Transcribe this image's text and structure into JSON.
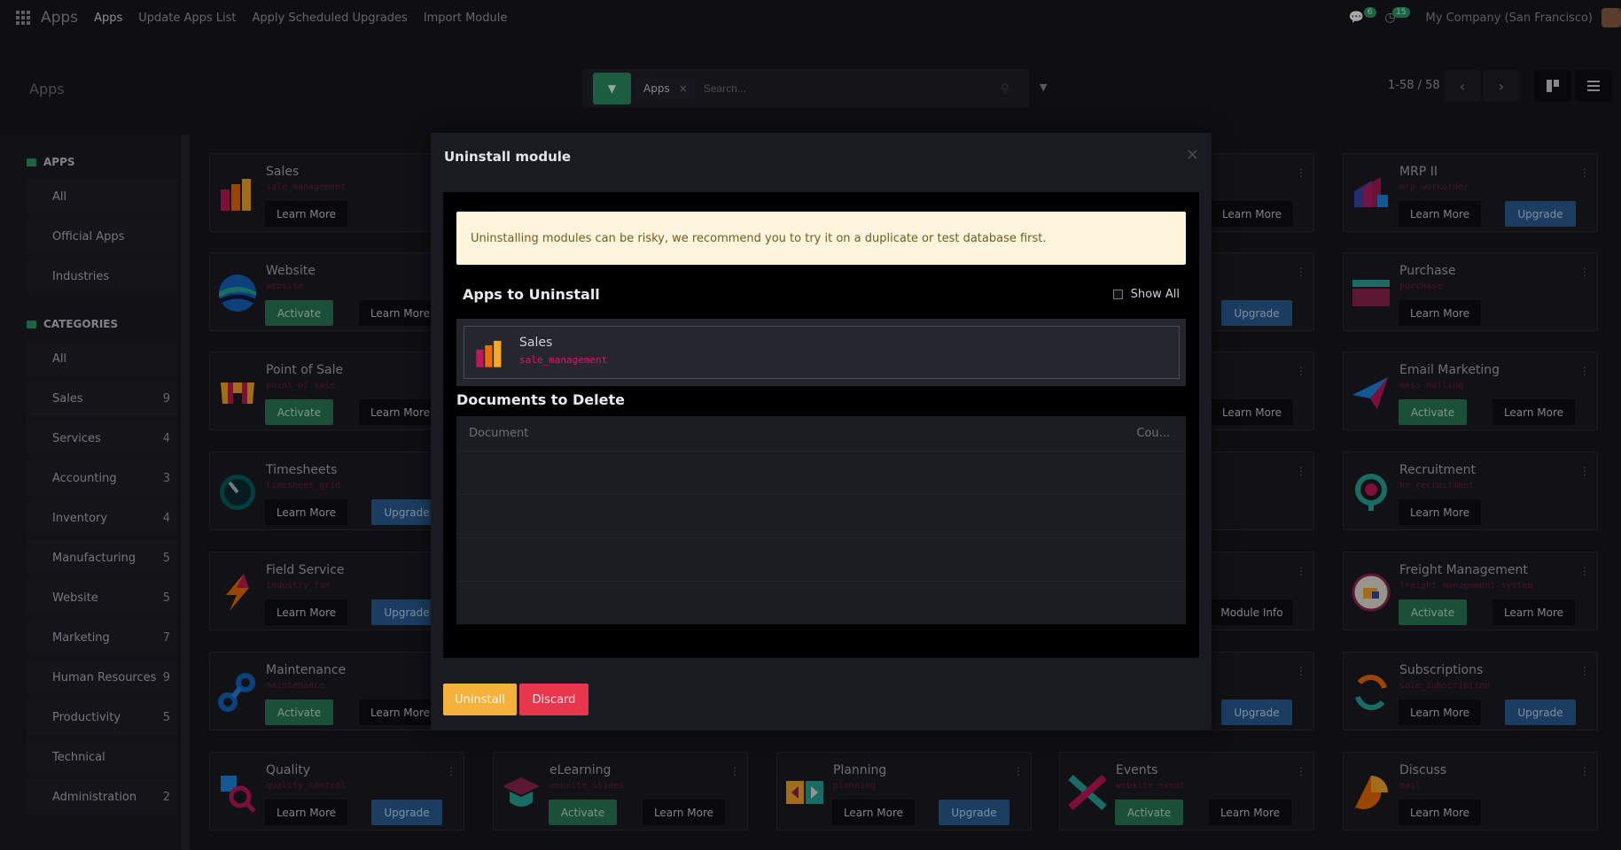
{
  "navbar": {
    "brand": "Apps",
    "links": [
      "Apps",
      "Update Apps List",
      "Apply Scheduled Upgrades",
      "Import Module"
    ],
    "messages_count": "6",
    "activities_count": "15",
    "company": "My Company (San Francisco)"
  },
  "control_panel": {
    "title": "Apps",
    "facet": "Apps",
    "search_placeholder": "Search...",
    "pager": "1-58 / 58"
  },
  "sidebar": {
    "apps_header": "APPS",
    "apps_items": [
      "All",
      "Official Apps",
      "Industries"
    ],
    "categories_header": "CATEGORIES",
    "categories": [
      {
        "label": "All",
        "count": ""
      },
      {
        "label": "Sales",
        "count": "9"
      },
      {
        "label": "Services",
        "count": "4"
      },
      {
        "label": "Accounting",
        "count": "3"
      },
      {
        "label": "Inventory",
        "count": "4"
      },
      {
        "label": "Manufacturing",
        "count": "5"
      },
      {
        "label": "Website",
        "count": "5"
      },
      {
        "label": "Marketing",
        "count": "7"
      },
      {
        "label": "Human Resources",
        "count": "9"
      },
      {
        "label": "Productivity",
        "count": "5"
      },
      {
        "label": "Technical",
        "count": ""
      },
      {
        "label": "Administration",
        "count": "2"
      }
    ]
  },
  "cards_left": [
    {
      "name": "Sales",
      "tech": "sale_management",
      "buttons": [
        "Learn More"
      ]
    },
    {
      "name": "Website",
      "tech": "website",
      "buttons": [
        "Activate",
        "Learn More"
      ]
    },
    {
      "name": "Point of Sale",
      "tech": "point_of_sale",
      "buttons": [
        "Activate",
        "Learn More"
      ]
    },
    {
      "name": "Timesheets",
      "tech": "timesheet_grid",
      "buttons": [
        "Learn More",
        "Upgrade"
      ]
    },
    {
      "name": "Field Service",
      "tech": "industry_fsm",
      "buttons": [
        "Learn More",
        "Upgrade"
      ]
    },
    {
      "name": "Maintenance",
      "tech": "maintenance",
      "buttons": [
        "Activate",
        "Learn More"
      ]
    }
  ],
  "cards_right": [
    {
      "name": "MRP II",
      "tech": "mrp_workorder",
      "buttons": [
        "Learn More",
        "Upgrade"
      ]
    },
    {
      "name": "Purchase",
      "tech": "purchase",
      "buttons": [
        "Learn More"
      ]
    },
    {
      "name": "Email Marketing",
      "tech": "mass_mailing",
      "buttons": [
        "Activate",
        "Learn More"
      ]
    },
    {
      "name": "Recruitment",
      "tech": "hr_recruitment",
      "buttons": [
        "Learn More"
      ]
    },
    {
      "name": "Freight Management",
      "tech": "freight_management_system",
      "buttons": [
        "Activate",
        "Learn More"
      ]
    },
    {
      "name": "Subscriptions",
      "tech": "sale_subscription",
      "buttons": [
        "Learn More",
        "Upgrade"
      ]
    }
  ],
  "cards_col4_buttons": [
    "Learn More",
    "Upgrade",
    "Learn More",
    "",
    "Module Info",
    "Upgrade"
  ],
  "cards_bottom": [
    {
      "name": "Quality",
      "tech": "quality_control",
      "buttons": [
        "Learn More",
        "Upgrade"
      ]
    },
    {
      "name": "eLearning",
      "tech": "website_slides",
      "buttons": [
        "Activate",
        "Learn More"
      ]
    },
    {
      "name": "Planning",
      "tech": "planning",
      "buttons": [
        "Learn More",
        "Upgrade"
      ]
    },
    {
      "name": "Events",
      "tech": "website_event",
      "buttons": [
        "Activate",
        "Learn More"
      ]
    },
    {
      "name": "Discuss",
      "tech": "mail",
      "buttons": [
        "Learn More"
      ]
    }
  ],
  "modal": {
    "title": "Uninstall module",
    "warning": "Uninstalling modules can be risky, we recommend you to try it on a duplicate or test database first.",
    "apps_section": "Apps to Uninstall",
    "show_all": "Show All",
    "app": {
      "name": "Sales",
      "tech": "sale_management"
    },
    "docs_section": "Documents to Delete",
    "col_document": "Document",
    "col_count": "Cou...",
    "uninstall": "Uninstall",
    "discard": "Discard"
  },
  "colors": {
    "activate": "#2a7a55",
    "upgrade": "#2a5f97",
    "uninstall": "#f5b23a",
    "discard": "#e8374d",
    "warning_bg": "#fff4dc"
  }
}
